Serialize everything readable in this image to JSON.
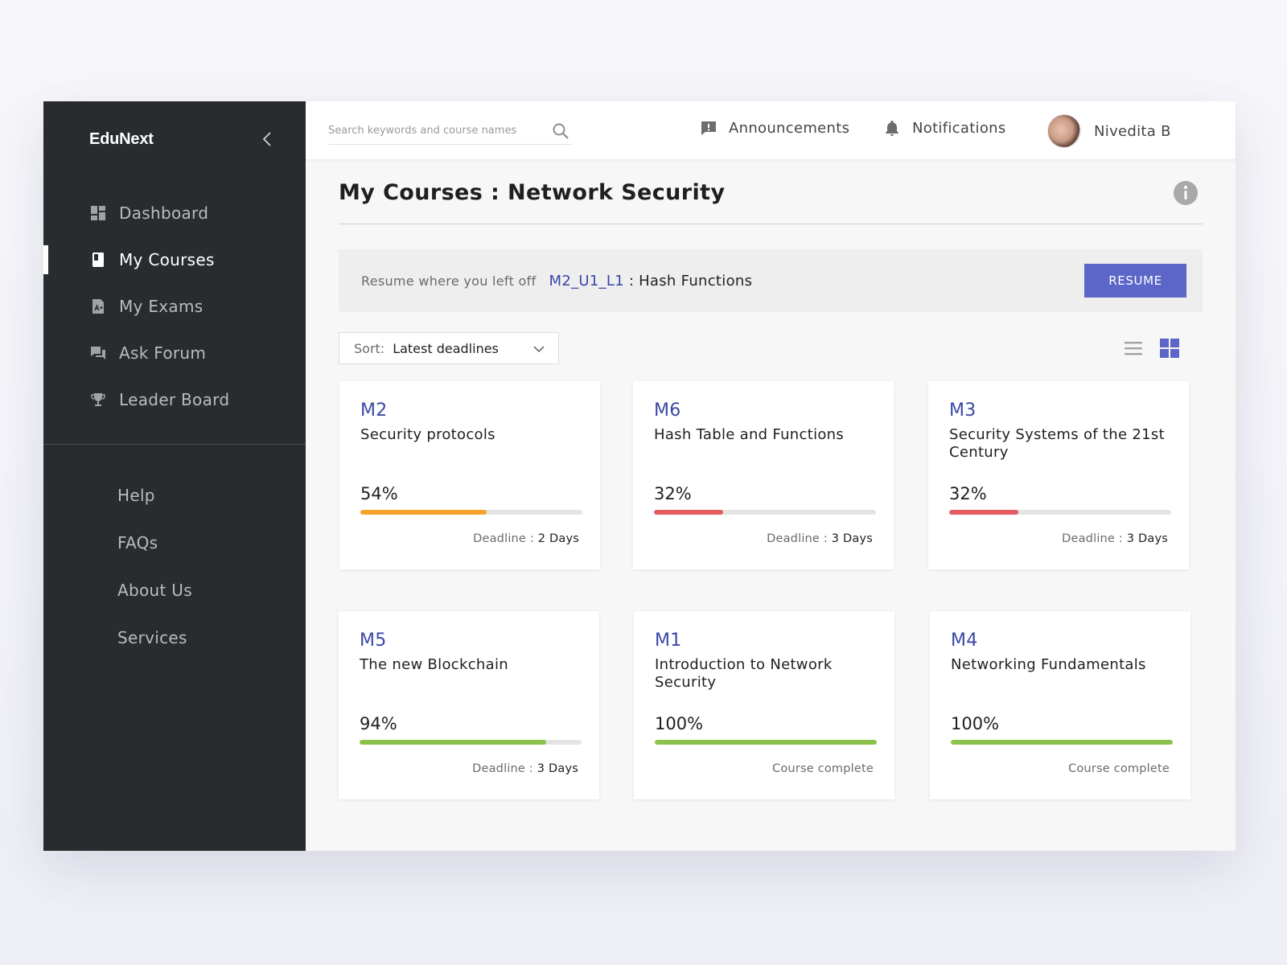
{
  "app": {
    "brand": "EduNext"
  },
  "sidebar": {
    "items": [
      {
        "label": "Dashboard",
        "icon": "dashboard-icon"
      },
      {
        "label": "My Courses",
        "icon": "book-icon",
        "active": true
      },
      {
        "label": "My Exams",
        "icon": "exam-icon"
      },
      {
        "label": "Ask Forum",
        "icon": "forum-icon"
      },
      {
        "label": "Leader Board",
        "icon": "trophy-icon"
      }
    ],
    "secondary": [
      {
        "label": "Help"
      },
      {
        "label": "FAQs"
      },
      {
        "label": "About Us"
      },
      {
        "label": "Services"
      }
    ]
  },
  "topbar": {
    "search_placeholder": "Search keywords and course names",
    "announcements": "Announcements",
    "notifications": "Notifications",
    "user_name": "Nivedita B"
  },
  "page": {
    "title": "My Courses : Network Security",
    "resume_text": "Resume where you left off",
    "resume_code": "M2_U1_L1",
    "resume_sep": ":",
    "resume_lesson": "Hash Functions",
    "resume_button": "RESUME",
    "sort_label": "Sort:",
    "sort_value": "Latest deadlines"
  },
  "colors": {
    "accent": "#5c66c9",
    "code_blue": "#3a47a7",
    "progress_orange": "#f5a42a",
    "progress_red": "#e25c5f",
    "progress_green": "#8bc34a",
    "sidebar_bg": "#282c2f"
  },
  "courses": [
    {
      "code": "M2",
      "title": "Security protocols",
      "percent_label": "54%",
      "progress": 0.57,
      "color": "#f5a42a",
      "foot_label": "Deadline :",
      "foot_days": "2 Days"
    },
    {
      "code": "M6",
      "title": "Hash Table and Functions",
      "percent_label": "32%",
      "progress": 0.31,
      "color": "#e25c5f",
      "foot_label": "Deadline :",
      "foot_days": "3 Days"
    },
    {
      "code": "M3",
      "title": "Security Systems of the 21st Century",
      "percent_label": "32%",
      "progress": 0.31,
      "color": "#e25c5f",
      "foot_label": "Deadline :",
      "foot_days": "3 Days"
    },
    {
      "code": "M5",
      "title": "The new Blockchain",
      "percent_label": "94%",
      "progress": 0.84,
      "color": "#8bc34a",
      "foot_label": "Deadline :",
      "foot_days": "3 Days"
    },
    {
      "code": "M1",
      "title": "Introduction to Network Security",
      "percent_label": "100%",
      "progress": 1.0,
      "color": "#8bc34a",
      "foot_label": "Course complete",
      "foot_days": ""
    },
    {
      "code": "M4",
      "title": "Networking Fundamentals",
      "percent_label": "100%",
      "progress": 1.0,
      "color": "#8bc34a",
      "foot_label": "Course complete",
      "foot_days": ""
    }
  ]
}
